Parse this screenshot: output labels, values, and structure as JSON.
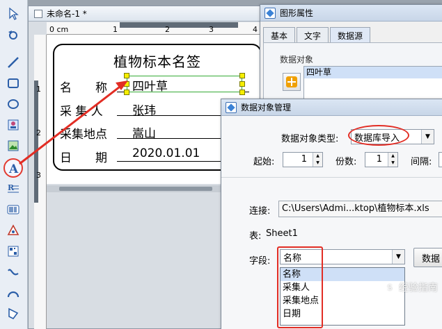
{
  "canvas": {
    "tab_title": "未命名-1 *",
    "ruler_h_labels": [
      "0 cm",
      "1",
      "2",
      "3",
      "4"
    ],
    "ruler_v_labels": [
      "1",
      "2",
      "3"
    ]
  },
  "label": {
    "title": "植物标本名签",
    "rows": [
      {
        "field": "名　　称",
        "value": "四叶草"
      },
      {
        "field": "采 集 人",
        "value": "张玮"
      },
      {
        "field": "采集地点",
        "value": "嵩山"
      },
      {
        "field": "日　　期",
        "value": "2020.01.01"
      }
    ]
  },
  "props_window": {
    "title": "图形属性",
    "tabs": [
      "基本",
      "文字",
      "数据源"
    ],
    "active_tab": "数据源",
    "data_object_label": "数据对象",
    "data_objects": [
      "四叶草"
    ]
  },
  "dom_window": {
    "title": "数据对象管理",
    "type_label": "数据对象类型:",
    "type_value": "数据库导入",
    "start_label": "起始:",
    "start_value": "1",
    "copies_label": "份数:",
    "copies_value": "1",
    "interval_label": "间隔:",
    "conn_label": "连接:",
    "conn_value": "C:\\Users\\Admi...ktop\\植物标本.xls",
    "table_label": "表:",
    "table_value": "Sheet1",
    "field_label": "字段:",
    "field_value": "名称",
    "field_options": [
      "名称",
      "采集人",
      "采集地点",
      "日期"
    ],
    "right_button": "数据"
  },
  "watermark": "经验指南",
  "colors": {
    "highlight": "#e22d24",
    "selection": "#cfe0f7",
    "handle": "#f6ee00"
  }
}
